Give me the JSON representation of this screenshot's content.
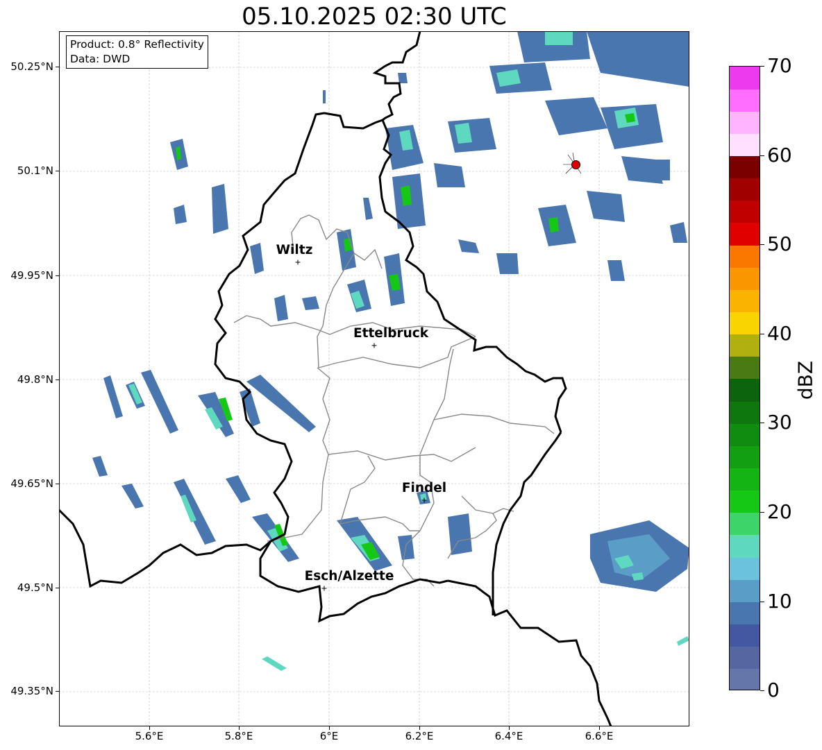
{
  "title": "05.10.2025 02:30 UTC",
  "info_box": {
    "line1": "Product: 0.8° Reflectivity",
    "line2": "Data: DWD"
  },
  "axes": {
    "lon_min": 5.4,
    "lon_max": 6.8,
    "lat_min": 49.3,
    "lat_max": 50.3,
    "lat_ticks": [
      "50.25°N",
      "50.1°N",
      "49.95°N",
      "49.8°N",
      "49.65°N",
      "49.5°N",
      "49.35°N"
    ],
    "lon_ticks": [
      "5.6°E",
      "5.8°E",
      "6°E",
      "6.2°E",
      "6.4°E",
      "6.6°E"
    ],
    "grid": true
  },
  "cities": [
    {
      "name": "Wiltz",
      "lon": 5.93,
      "lat": 49.969
    },
    {
      "name": "Ettelbruck",
      "lon": 6.1,
      "lat": 49.849
    },
    {
      "name": "Findel",
      "lon": 6.21,
      "lat": 49.627
    },
    {
      "name": "Esch/Alzette",
      "lon": 5.99,
      "lat": 49.499
    }
  ],
  "radar_site": {
    "lon": 6.547,
    "lat": 50.109
  },
  "colorbar": {
    "label": "dBZ",
    "min": 0,
    "max": 70,
    "ticks": [
      "0",
      "10",
      "20",
      "30",
      "40",
      "50",
      "60",
      "70"
    ],
    "colors": [
      "#6577aa",
      "#5566a0",
      "#4358a0",
      "#4a76b0",
      "#5a9ec8",
      "#6ac2dc",
      "#5fd8c0",
      "#3dd46a",
      "#16c816",
      "#14b414",
      "#12a012",
      "#108c10",
      "#0e780e",
      "#0c640c",
      "#4a7a14",
      "#b0b010",
      "#fad400",
      "#fab400",
      "#fa9600",
      "#fa7800",
      "#e00000",
      "#c00000",
      "#a00000",
      "#7a0000",
      "#ffe0ff",
      "#ffb4ff",
      "#ff6eff",
      "#ee3aee"
    ]
  }
}
